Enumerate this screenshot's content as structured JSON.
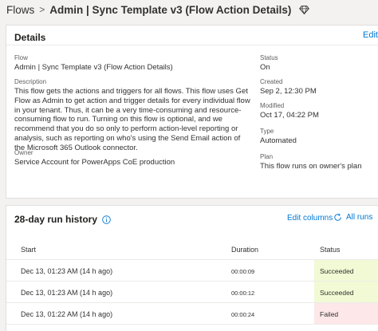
{
  "breadcrumb": {
    "root": "Flows",
    "separator": ">",
    "current": "Admin | Sync Template v3 (Flow Action Details)"
  },
  "details": {
    "title": "Details",
    "edit_label": "Edit",
    "flow_label": "Flow",
    "flow_value": "Admin | Sync Template v3 (Flow Action Details)",
    "description_label": "Description",
    "description_value": "This flow gets the actions and triggers for all flows. This flow uses Get Flow as Admin to get action and trigger details for every individual flow in your tenant. Thus, it can be a very time-consuming and resource-consuming flow to run. Turning on this flow is optional, and we recommend that you do so only to perform action-level reporting or analysis, such as reporting on who's using the Send Email action of the Microsoft 365 Outlook connector.",
    "owner_label": "Owner",
    "owner_value": "Service Account for PowerApps CoE production",
    "status_label": "Status",
    "status_value": "On",
    "created_label": "Created",
    "created_value": "Sep 2, 12:30 PM",
    "modified_label": "Modified",
    "modified_value": "Oct 17, 04:22 PM",
    "type_label": "Type",
    "type_value": "Automated",
    "plan_label": "Plan",
    "plan_value": "This flow runs on owner's plan"
  },
  "run_history": {
    "title": "28-day run history",
    "edit_columns_label": "Edit columns",
    "all_runs_label": "All runs",
    "columns": [
      "Start",
      "Duration",
      "Status"
    ],
    "rows": [
      {
        "start": "Dec 13, 01:23 AM (14 h ago)",
        "duration": "00:00:09",
        "status": "Succeeded",
        "status_color": "#f1fad4"
      },
      {
        "start": "Dec 13, 01:23 AM (14 h ago)",
        "duration": "00:00:12",
        "status": "Succeeded",
        "status_color": "#f1fad4"
      },
      {
        "start": "Dec 13, 01:22 AM (14 h ago)",
        "duration": "00:00:24",
        "status": "Failed",
        "status_color": "#fde7e9"
      }
    ]
  },
  "colors": {
    "accent": "#0078d4",
    "succeeded_bg": "#f1fad4",
    "failed_bg": "#fde7e9"
  },
  "icons": {
    "premium": "diamond-icon",
    "info": "info-icon",
    "refresh": "refresh-icon"
  }
}
